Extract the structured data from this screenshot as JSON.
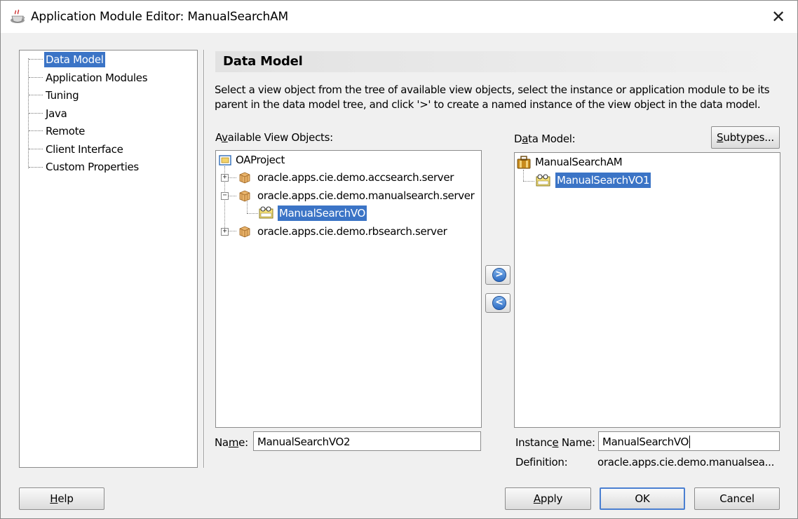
{
  "window": {
    "title": "Application Module Editor: ManualSearchAM"
  },
  "nav": {
    "items": [
      {
        "label": "Data Model",
        "selected": true
      },
      {
        "label": "Application Modules"
      },
      {
        "label": "Tuning"
      },
      {
        "label": "Java"
      },
      {
        "label": "Remote"
      },
      {
        "label": "Client Interface"
      },
      {
        "label": "Custom Properties"
      }
    ]
  },
  "header": {
    "title": "Data Model"
  },
  "description": "Select a view object from the tree of available view objects, select the instance or application module to be its parent in the data model tree, and click '>' to create a named instance of the view object in the data model.",
  "available": {
    "label_pre": "A",
    "label_accel": "v",
    "label_post": "ailable View Objects:",
    "nodes": {
      "root": "OAProject",
      "pkg1": "oracle.apps.cie.demo.accsearch.server",
      "pkg2": "oracle.apps.cie.demo.manualsearch.server",
      "vo": "ManualSearchVO",
      "pkg3": "oracle.apps.cie.demo.rbsearch.server"
    },
    "name_label_pre": "Na",
    "name_label_accel": "m",
    "name_label_post": "e:",
    "name_value": "ManualSearchVO2"
  },
  "data_model": {
    "label_pre": "D",
    "label_accel": "a",
    "label_post": "ta Model:",
    "subtypes_pre": "",
    "subtypes_accel": "S",
    "subtypes_post": "ubtypes...",
    "nodes": {
      "root": "ManualSearchAM",
      "instance": "ManualSearchVO1"
    },
    "instance_label_pre": "Instanc",
    "instance_label_accel": "e",
    "instance_label_post": " Name:",
    "instance_value": "ManualSearchVO",
    "definition_label": "Definition:",
    "definition_value": "oracle.apps.cie.demo.manualsea..."
  },
  "shuttle": {
    "add": ">",
    "remove": "<"
  },
  "buttons": {
    "help_accel": "H",
    "help_post": "elp",
    "apply_accel": "A",
    "apply_post": "pply",
    "ok": "OK",
    "cancel": "Cancel"
  },
  "colors": {
    "selection": "#3b74c6",
    "default_border": "#4a7fd1"
  }
}
